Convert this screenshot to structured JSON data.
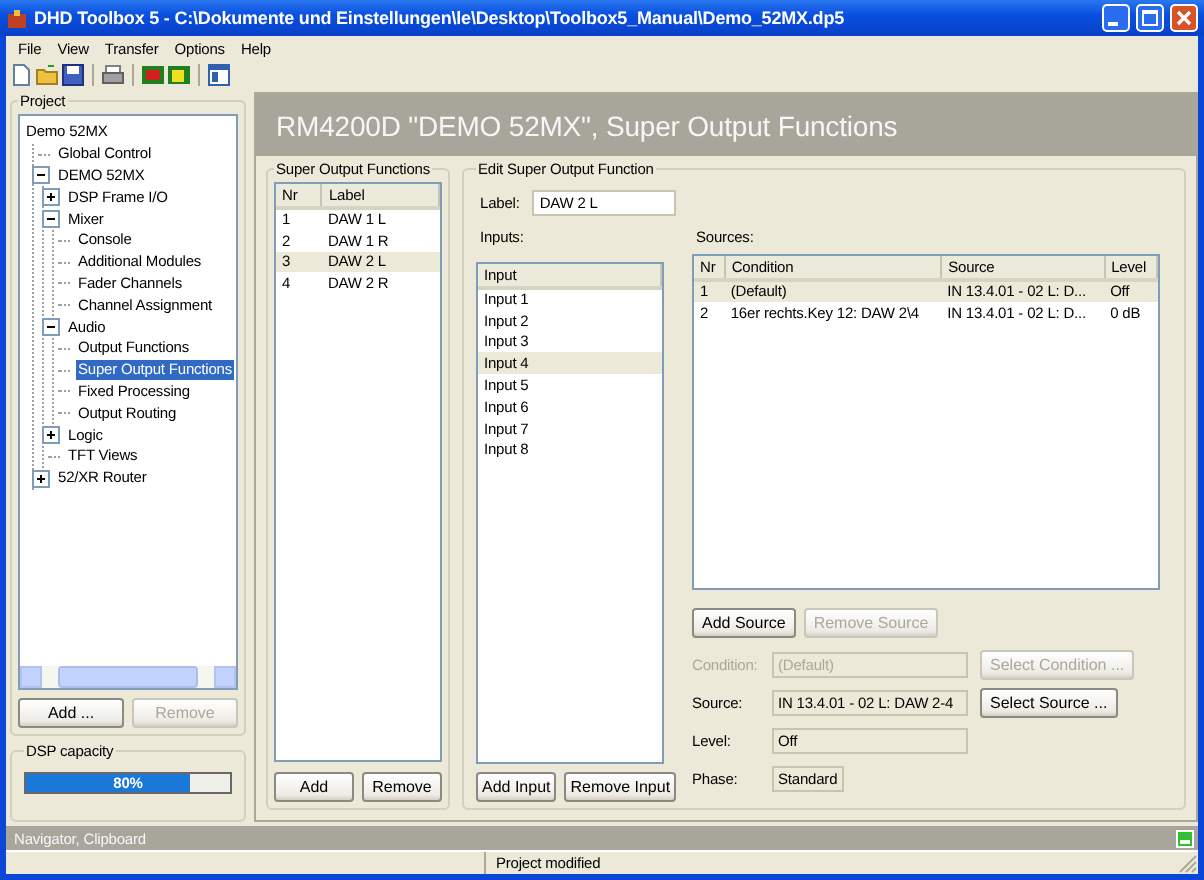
{
  "window": {
    "title": "DHD Toolbox 5 - C:\\Dokumente und Einstellungen\\le\\Desktop\\Toolbox5_Manual\\Demo_52MX.dp5"
  },
  "menu": [
    "File",
    "View",
    "Transfer",
    "Options",
    "Help"
  ],
  "toolbar": [
    {
      "kind": "new"
    },
    {
      "kind": "open"
    },
    {
      "kind": "save"
    },
    {
      "kind": "separator"
    },
    {
      "kind": "print"
    },
    {
      "kind": "separator"
    },
    {
      "kind": "disconnect"
    },
    {
      "kind": "connect"
    },
    {
      "kind": "separator"
    },
    {
      "kind": "window"
    }
  ],
  "project": {
    "title": "Project",
    "tree": [
      {
        "label": "Demo 52MX",
        "selected": false,
        "children": [
          {
            "label": "Global Control",
            "selected": false
          },
          {
            "label": "DEMO 52MX",
            "selected": false,
            "expanded": true,
            "children": [
              {
                "label": "DSP Frame I/O",
                "selected": false,
                "expanded": false
              },
              {
                "label": "Mixer",
                "selected": false,
                "expanded": true,
                "children": [
                  {
                    "label": "Console",
                    "selected": false
                  },
                  {
                    "label": "Additional Modules",
                    "selected": false
                  },
                  {
                    "label": "Fader Channels",
                    "selected": false
                  },
                  {
                    "label": "Channel Assignment",
                    "selected": false
                  }
                ]
              },
              {
                "label": "Audio",
                "selected": false,
                "expanded": true,
                "children": [
                  {
                    "label": "Output Functions",
                    "selected": false
                  },
                  {
                    "label": "Super Output Functions",
                    "selected": true
                  },
                  {
                    "label": "Fixed Processing",
                    "selected": false
                  },
                  {
                    "label": "Output Routing",
                    "selected": false
                  }
                ]
              },
              {
                "label": "Logic",
                "selected": false,
                "expanded": false
              },
              {
                "label": "TFT Views",
                "selected": false
              }
            ]
          },
          {
            "label": "52/XR Router",
            "selected": false,
            "expanded": false
          }
        ]
      }
    ],
    "buttons": [
      {
        "label": "Add ...",
        "disabled": false
      },
      {
        "label": "Remove",
        "disabled": true
      }
    ]
  },
  "dsp": {
    "title": "DSP capacity",
    "level": 0.8,
    "reading": "80%"
  },
  "header": "RM4200D \"DEMO 52MX\", Super Output Functions",
  "functions": {
    "title": "Super Output Functions",
    "columns": [
      "Nr",
      "Label"
    ],
    "rows": [
      {
        "cells": [
          "1",
          "DAW 1 L"
        ],
        "selected": false
      },
      {
        "cells": [
          "2",
          "DAW 1 R"
        ],
        "selected": false
      },
      {
        "cells": [
          "3",
          "DAW 2 L"
        ],
        "selected": true
      },
      {
        "cells": [
          "4",
          "DAW 2 R"
        ],
        "selected": false
      }
    ],
    "buttons": [
      {
        "label": "Add",
        "disabled": false
      },
      {
        "label": "Remove",
        "disabled": false
      }
    ]
  },
  "edit": {
    "title": "Edit Super Output Function",
    "label_caption": "Label:",
    "label_value": "DAW 2 L",
    "inputs_caption": "Inputs:",
    "inputs": {
      "columns": [
        "Input"
      ],
      "rows": [
        {
          "cells": [
            "Input 1"
          ],
          "selected": false
        },
        {
          "cells": [
            "Input 2"
          ],
          "selected": false
        },
        {
          "cells": [
            "Input 3"
          ],
          "selected": false
        },
        {
          "cells": [
            "Input 4"
          ],
          "selected": true
        },
        {
          "cells": [
            "Input 5"
          ],
          "selected": false
        },
        {
          "cells": [
            "Input 6"
          ],
          "selected": false
        },
        {
          "cells": [
            "Input 7"
          ],
          "selected": false
        },
        {
          "cells": [
            "Input 8"
          ],
          "selected": false
        }
      ]
    },
    "input_buttons": [
      {
        "label": "Add Input",
        "disabled": false
      },
      {
        "label": "Remove Input",
        "disabled": false
      }
    ],
    "sources_caption": "Sources:",
    "sources": {
      "columns": [
        "Nr",
        "Condition",
        "Source",
        "Level"
      ],
      "rows": [
        {
          "cells": [
            "1",
            "(Default)",
            "IN 13.4.01 - 02 L: D...",
            "Off"
          ],
          "selected": true
        },
        {
          "cells": [
            "2",
            "16er rechts.Key 12: DAW 2\\4",
            "IN 13.4.01 - 02 L: D...",
            "0 dB"
          ],
          "selected": false
        }
      ]
    },
    "source_buttons": [
      {
        "label": "Add Source",
        "disabled": false
      },
      {
        "label": "Remove Source",
        "disabled": true
      }
    ],
    "fields": [
      {
        "label": "Condition:",
        "value": "(Default)",
        "disabled": true,
        "button": {
          "label": "Select Condition ...",
          "disabled": true
        }
      },
      {
        "label": "Source:",
        "value": "IN 13.4.01 - 02 L: DAW 2-4",
        "button": {
          "label": "Select Source ..."
        }
      },
      {
        "label": "Level:",
        "value": "Off"
      },
      {
        "label": "Phase:",
        "value": "Standard",
        "short": true
      }
    ]
  },
  "navigator": "Navigator, Clipboard",
  "status_bar": {
    "message": "Project modified"
  }
}
